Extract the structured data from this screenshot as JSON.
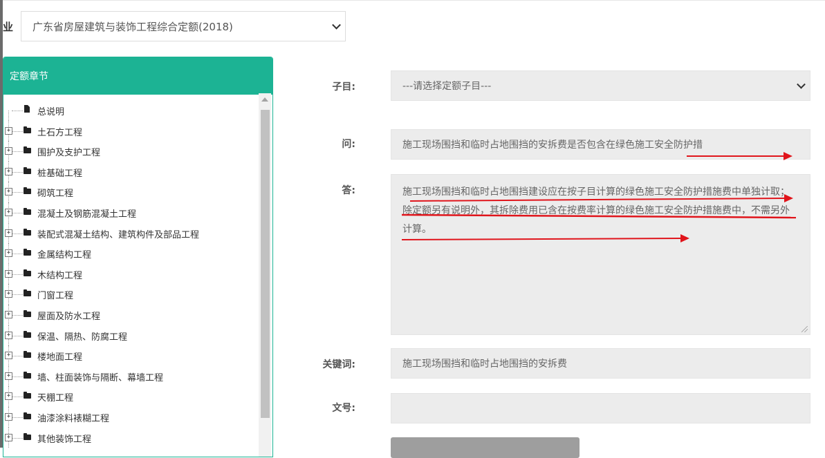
{
  "major": {
    "label": "业",
    "selected": "广东省房屋建筑与装饰工程综合定额(2018)"
  },
  "tree": {
    "header": "定额章节",
    "items": [
      {
        "label": "总说明",
        "type": "file"
      },
      {
        "label": "土石方工程",
        "type": "folder"
      },
      {
        "label": "围护及支护工程",
        "type": "folder"
      },
      {
        "label": "桩基础工程",
        "type": "folder"
      },
      {
        "label": "砌筑工程",
        "type": "folder"
      },
      {
        "label": "混凝土及钢筋混凝土工程",
        "type": "folder"
      },
      {
        "label": "装配式混凝土结构、建筑构件及部品工程",
        "type": "folder"
      },
      {
        "label": "金属结构工程",
        "type": "folder"
      },
      {
        "label": "木结构工程",
        "type": "folder"
      },
      {
        "label": "门窗工程",
        "type": "folder"
      },
      {
        "label": "屋面及防水工程",
        "type": "folder"
      },
      {
        "label": "保温、隔热、防腐工程",
        "type": "folder"
      },
      {
        "label": "楼地面工程",
        "type": "folder"
      },
      {
        "label": "墙、柱面装饰与隔断、幕墙工程",
        "type": "folder"
      },
      {
        "label": "天棚工程",
        "type": "folder"
      },
      {
        "label": "油漆涂料裱糊工程",
        "type": "folder"
      },
      {
        "label": "其他装饰工程",
        "type": "folder"
      }
    ],
    "expand_glyph": "+"
  },
  "form": {
    "subitem_label": "子目:",
    "subitem_selected": "---请选择定额子目---",
    "question_label": "问:",
    "question_value": "施工现场围挡和临时占地围挡的安拆费是否包含在绿色施工安全防护措",
    "answer_label": "答:",
    "answer_value": "施工现场围挡和临时占地围挡建设应在按子目计算的绿色施工安全防护措施费中单独计取；除定额另有说明外，其拆除费用已含在按费率计算的绿色施工安全防护措施费中，不需另外计算。",
    "keyword_label": "关键词:",
    "keyword_value": "施工现场围挡和临时占地围挡的安拆费",
    "doc_label": "文号:",
    "doc_value": ""
  },
  "colors": {
    "accent": "#1cb394",
    "annotation": "#e0141b"
  },
  "icons": {
    "select_arrow": "chevron-down-icon",
    "tree_folder": "folder-icon",
    "tree_file": "file-icon"
  }
}
